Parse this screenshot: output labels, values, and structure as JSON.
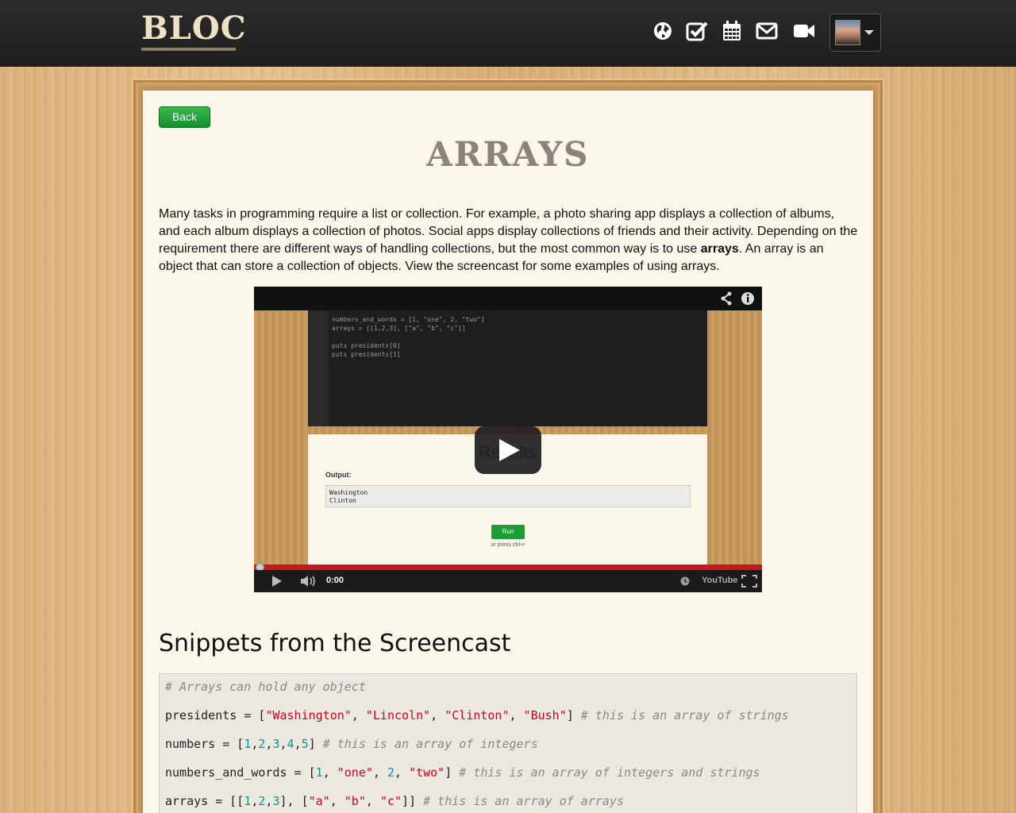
{
  "header": {
    "logo": "BLOC",
    "nav_icons": [
      {
        "name": "globe-icon"
      },
      {
        "name": "checkbox-icon"
      },
      {
        "name": "calendar-icon"
      },
      {
        "name": "envelope-icon"
      },
      {
        "name": "video-camera-icon"
      }
    ]
  },
  "page": {
    "back_label": "Back",
    "title": "ARRAYS",
    "intro_part1": "Many tasks in programming require a list or collection. For example, a photo sharing app displays a collection of albums, and each album displays a collection of photos. Social apps display collections of friends and their activity. Depending on the requirement there are different ways of handling collections, but the most common way is to use ",
    "intro_bold": "arrays",
    "intro_part2": ". An array is an object that can store a collection of objects. View the screencast for some examples of using arrays."
  },
  "video": {
    "editor_code": "numbers_and_words = [1, \"one\", 2, \"two\"]\narrays = [[1,2,3], [\"a\", \"b\", \"c\"]]\n\nputs presidents[0]\nputs presidents[1]",
    "results_title": "Results",
    "output_label": "Output:",
    "output_text": "Washington\nClinton",
    "run_label": "Run",
    "run_hint": "or press ctrl+r",
    "time": "0:00",
    "logo": "YouTube",
    "progress": 0
  },
  "snippets": {
    "title": "Snippets from the Screencast",
    "lines": [
      "# Arrays can hold any object",
      "presidents = [\"Washington\", \"Lincoln\", \"Clinton\", \"Bush\"] # this is an array of strings",
      "numbers = [1,2,3,4,5] # this is an array of integers",
      "numbers_and_words = [1, \"one\", 2, \"two\"] # this is an array of integers and strings",
      "arrays = [[1,2,3], [\"a\", \"b\", \"c\"]] # this is an array of arrays"
    ]
  }
}
